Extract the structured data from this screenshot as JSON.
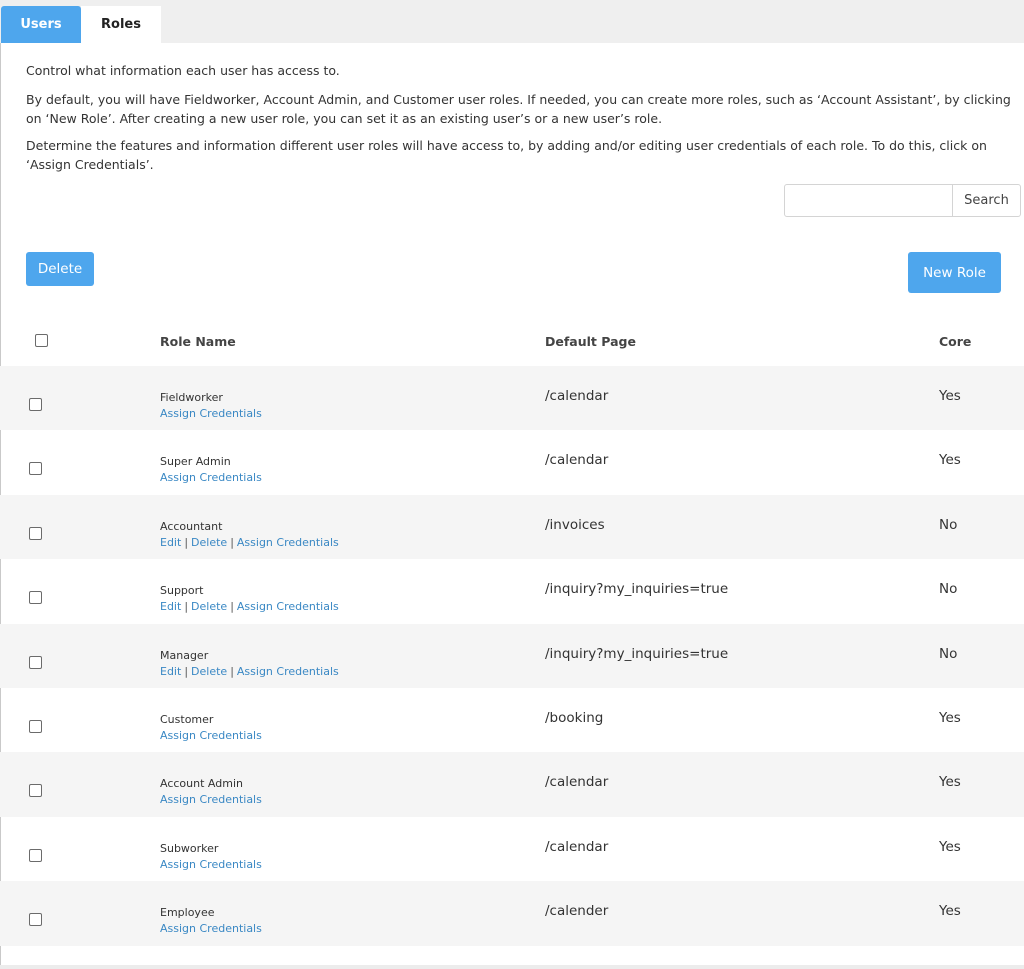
{
  "tabs": {
    "users": "Users",
    "roles": "Roles"
  },
  "description": {
    "line1": "Control what information each user has access to.",
    "line2": "By default, you will have Fieldworker, Account Admin, and Customer user roles. If needed, you can create more roles, such as ‘Account Assistant’, by clicking on ‘New Role’. After creating a new user role, you can set it as an existing user’s or a new user’s role.",
    "line3": "Determine the features and information different user roles will have access to, by adding and/or editing user credentials of each role. To do this, click on ‘Assign Credentials’."
  },
  "search": {
    "value": "",
    "button": "Search"
  },
  "toolbar": {
    "delete_label": "Delete",
    "new_role_label": "New Role"
  },
  "table": {
    "headers": {
      "role_name": "Role Name",
      "default_page": "Default Page",
      "core": "Core"
    },
    "action_labels": {
      "edit": "Edit",
      "delete": "Delete",
      "assign": "Assign Credentials",
      "separator": "|"
    },
    "rows": [
      {
        "name": "Fieldworker",
        "page": "/calendar",
        "core": "Yes",
        "editable": false
      },
      {
        "name": "Super Admin",
        "page": "/calendar",
        "core": "Yes",
        "editable": false
      },
      {
        "name": "Accountant",
        "page": "/invoices",
        "core": "No",
        "editable": true
      },
      {
        "name": "Support",
        "page": "/inquiry?my_inquiries=true",
        "core": "No",
        "editable": true
      },
      {
        "name": "Manager",
        "page": "/inquiry?my_inquiries=true",
        "core": "No",
        "editable": true
      },
      {
        "name": "Customer",
        "page": "/booking",
        "core": "Yes",
        "editable": false
      },
      {
        "name": "Account Admin",
        "page": "/calendar",
        "core": "Yes",
        "editable": false
      },
      {
        "name": "Subworker",
        "page": "/calendar",
        "core": "Yes",
        "editable": false
      },
      {
        "name": "Employee",
        "page": "/calender",
        "core": "Yes",
        "editable": false
      }
    ]
  },
  "colors": {
    "accent": "#4ea6ed",
    "link": "#3a88c4",
    "row_shade": "#f5f5f5"
  }
}
